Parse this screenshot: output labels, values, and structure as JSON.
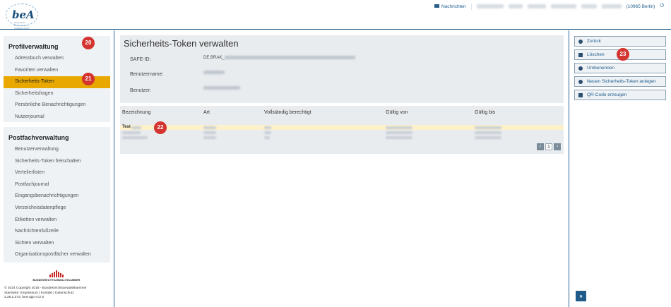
{
  "header": {
    "logo_text": "beA",
    "logo_tagline": "besonderes elektronisches Anwaltspostfach",
    "messages_label": "Nachrichten",
    "timezone_text": "(10965 Berlin)"
  },
  "left": {
    "section1_title": "Profilverwaltung",
    "section1_items": [
      "Adressbuch verwalten",
      "Favoriten verwalten",
      "Sicherheits-Token",
      "Sicherheitsfragen",
      "Persönliche Benachrichtigungen",
      "Nutzerjournal"
    ],
    "section2_title": "Postfachverwaltung",
    "section2_items": [
      "Benutzerverwaltung",
      "Sicherheits-Token freischalten",
      "Verteilerlisten",
      "Postfachjournal",
      "Eingangsbenachrichtigungen",
      "Verzeichnisdatenpflege",
      "Etiketten verwalten",
      "Nachrichtenfußzeile",
      "Sichten verwalten",
      "Organisationspostfächer verwalten"
    ],
    "brak_name": "BUNDESRECHTSANWALTSKAMMER",
    "footer_line1": "© 2024 Copyright 2018 - Bundesrechtsanwaltskammer",
    "footer_line2": "Startseite | Impressum | Kontakt | Datenschutz",
    "footer_line3": "3.28.2.373, bea-app-cc2-2"
  },
  "main": {
    "title": "Sicherheits-Token verwalten",
    "safe_id_label": "SAFE-ID:",
    "safe_id_value": "DE.BRAK_",
    "username_label": "Benutzername:",
    "user_label": "Benutzer:",
    "table_headers": [
      "Bezeichnung",
      "Art",
      "Vollständig berechtigt",
      "Gültig von",
      "Gültig bis"
    ],
    "first_row_name": "Test",
    "page_number": "1"
  },
  "right": {
    "buttons": [
      "Zurück",
      "Löschen",
      "Umbenennen",
      "Neuen Sicherheits-Token anlegen",
      "QR-Code erzeugen"
    ]
  },
  "badges": [
    "20",
    "21",
    "22",
    "23"
  ],
  "colors": {
    "accent": "#e8a800",
    "brand": "#1e5a8a",
    "badge": "#d4342f"
  }
}
